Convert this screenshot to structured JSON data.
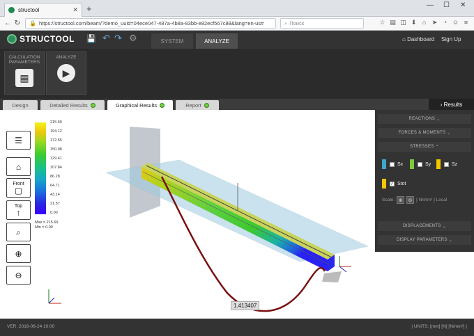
{
  "browser": {
    "tab_title": "structool",
    "url": "https://structool.com/beam/?demo_uuid=04ece047-487a-4b8a-83bb-e82ecf567c88&lang=en-us#",
    "search_placeholder": "Поиск"
  },
  "app": {
    "logo": "STRUCTOOL",
    "mode_tabs": [
      "SYSTEM",
      "ANALYZE"
    ],
    "active_mode": "ANALYZE",
    "dashboard": "Dashboard",
    "signup": "Sign Up"
  },
  "tools": [
    {
      "label": "CALCULATION PARAMETERS",
      "icon": "calculator-icon"
    },
    {
      "label": "ANALYZE",
      "icon": "play-icon"
    }
  ],
  "result_tabs": [
    "Design",
    "Detailed Results",
    "Graphical Results",
    "Report"
  ],
  "active_result_tab": "Graphical Results",
  "results_button": "Results",
  "view_buttons": [
    "Front",
    "Top"
  ],
  "legend": {
    "ticks": [
      "215.69",
      "194.12",
      "172.55",
      "150.98",
      "129.41",
      "107.84",
      "86.28",
      "64.71",
      "43.14",
      "21.57",
      "0.00"
    ],
    "max": "Max = 215.69",
    "min": "Min = 0.00"
  },
  "panel": {
    "sections_top": [
      "REACTIONS",
      "FORCES & MOMENTS",
      "STRESSES"
    ],
    "stresses": [
      {
        "name": "Sx",
        "color": "#3fa7c9",
        "checked": false
      },
      {
        "name": "Sy",
        "color": "#7cc93b",
        "checked": false
      },
      {
        "name": "Sz",
        "color": "#f2c500",
        "checked": false
      },
      {
        "name": "Stot",
        "color": "#f2c500",
        "checked": true
      }
    ],
    "scale_label": "Scale:",
    "scale_units": "[ N/mm² ] Local",
    "sections_bottom": [
      "DISPLACEMENTS",
      "DISPLAY PARAMETERS"
    ]
  },
  "value_tag": "1.413407",
  "footer": {
    "version": "VER. 2016-06-24 10:00",
    "units": "| UNITS: [mm] [N] [N/mm²] |"
  }
}
